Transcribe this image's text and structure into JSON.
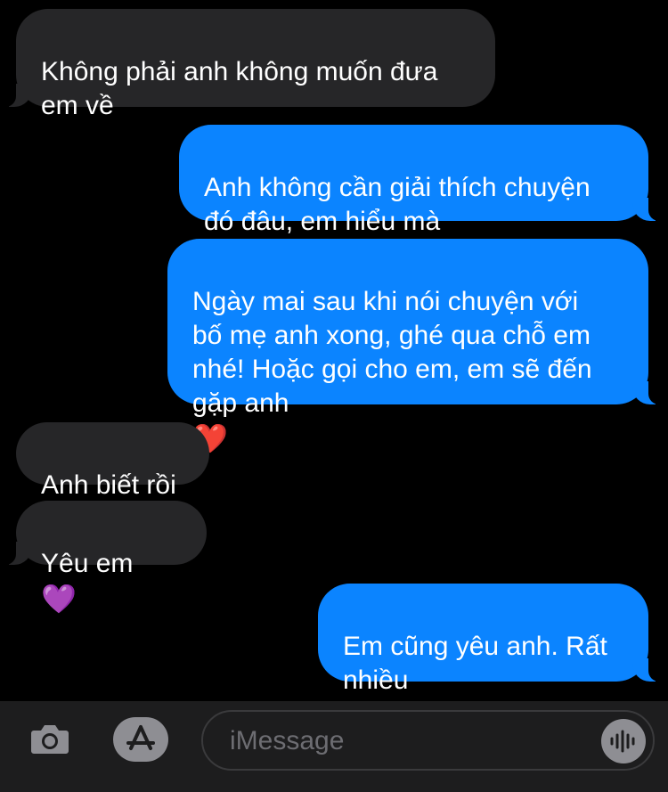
{
  "messages": [
    {
      "id": "m1",
      "direction": "received",
      "text": "Không phải anh không muốn đưa\nem về"
    },
    {
      "id": "m2",
      "direction": "sent",
      "text": "Anh không cần giải thích chuyện\nđó đâu, em hiểu mà"
    },
    {
      "id": "m3",
      "direction": "sent",
      "text": "Ngày mai sau khi nói chuyện với\nbố mẹ anh xong, ghé qua chỗ em\nnhé! Hoặc gọi cho em, em sẽ đến\ngặp anh",
      "emoji": "❤️"
    },
    {
      "id": "m4",
      "direction": "received",
      "text": "Anh biết rồi"
    },
    {
      "id": "m5",
      "direction": "received",
      "text": "Yêu em",
      "emoji": "💜"
    },
    {
      "id": "m6",
      "direction": "sent",
      "text": "Em cũng yêu anh. Rất\nnhiều",
      "emoji": "❣️ ❣️"
    }
  ],
  "input_bar": {
    "placeholder": "iMessage",
    "camera_icon": "camera-icon",
    "apps_icon": "app-store-icon",
    "audio_icon": "audio-waveform-icon"
  },
  "colors": {
    "background": "#000000",
    "received_bubble": "#262628",
    "sent_bubble": "#0b84ff",
    "text": "#ffffff",
    "placeholder": "#6d6d72"
  }
}
